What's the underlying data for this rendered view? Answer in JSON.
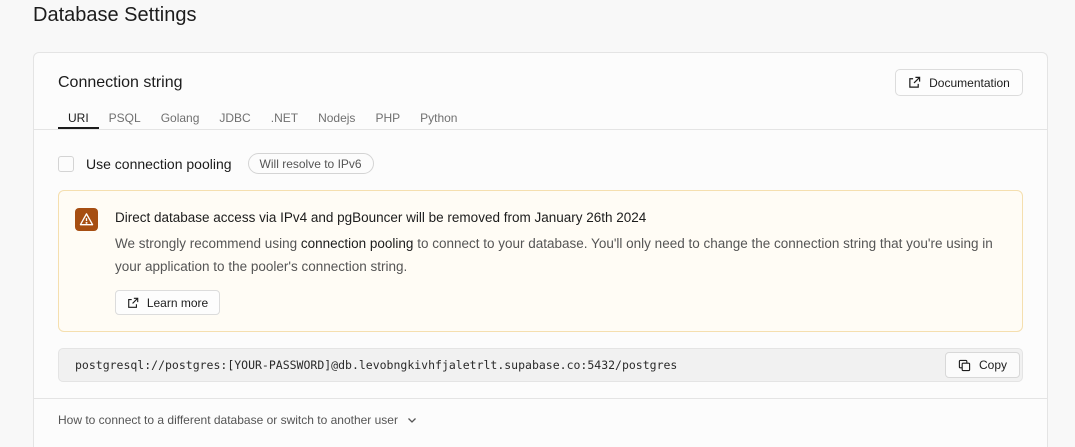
{
  "page": {
    "title": "Database Settings"
  },
  "connection": {
    "title": "Connection string",
    "documentation_label": "Documentation",
    "tabs": [
      "URI",
      "PSQL",
      "Golang",
      "JDBC",
      ".NET",
      "Nodejs",
      "PHP",
      "Python"
    ],
    "active_tab": "URI",
    "pooling_label": "Use connection pooling",
    "pooling_badge": "Will resolve to IPv6",
    "alert": {
      "title": "Direct database access via IPv4 and pgBouncer will be removed from January 26th 2024",
      "body_prefix": "We strongly recommend using ",
      "body_strong": "connection pooling",
      "body_suffix": " to connect to your database. You'll only need to change the connection string that you're using in your application to the pooler's connection string.",
      "learn_more_label": "Learn more",
      "color": "#a64e12"
    },
    "connection_string": "postgresql://postgres:[YOUR-PASSWORD]@db.levobngkivhfjaletrlt.supabase.co:5432/postgres",
    "copy_label": "Copy",
    "footer_link": "How to connect to a different database or switch to another user"
  },
  "icons": {
    "external_link": "external-link-icon",
    "warning": "warning-icon",
    "copy": "copy-icon",
    "chevron": "chevron-down-icon"
  }
}
